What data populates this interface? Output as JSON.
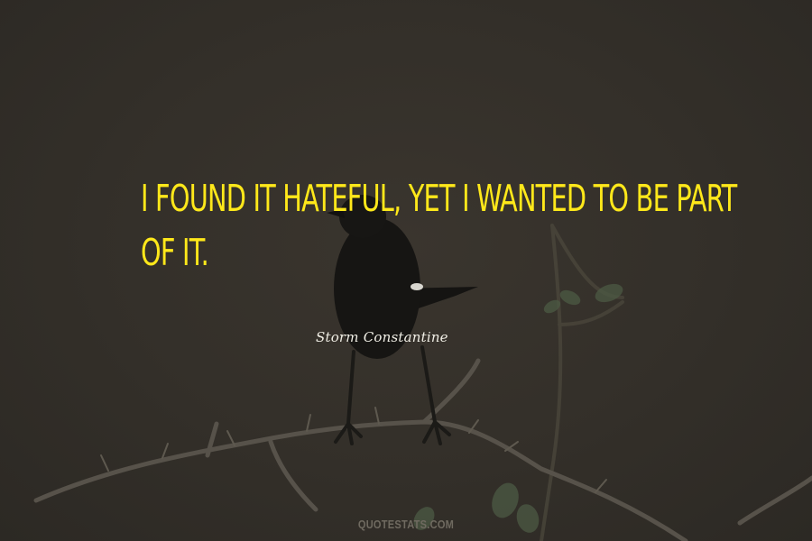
{
  "quote": {
    "lines": [
      "I FOUND IT HATEFUL, YET I WANTED TO BE PART",
      "OF IT."
    ],
    "color": "#ffe81a"
  },
  "author": {
    "name": "Storm Constantine",
    "color": "#f1efe6"
  },
  "watermark": {
    "text": "QUOTESTATS.COM",
    "color": "#6f6a60"
  },
  "background": {
    "subject": "black bird perched on a thorny branch",
    "color": "#35312a"
  }
}
